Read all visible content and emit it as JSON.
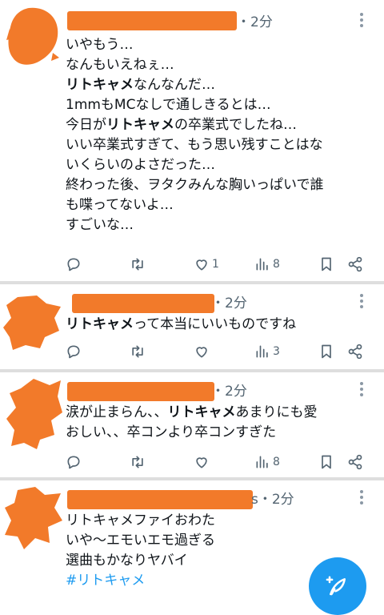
{
  "tweets": [
    {
      "time": "・2分",
      "lines": [
        [
          {
            "t": "いやもう…"
          }
        ],
        [
          {
            "t": "なんもいえねぇ…"
          }
        ],
        [
          {
            "t": "リトキャメ",
            "b": true
          },
          {
            "t": "なんなんだ…"
          }
        ],
        [
          {
            "t": "1mmもMCなしで通しきるとは…"
          }
        ],
        [
          {
            "t": "今日が"
          },
          {
            "t": "リトキャメ",
            "b": true
          },
          {
            "t": "の卒業式でしたね…"
          }
        ],
        [
          {
            "t": "いい卒業式すぎて、もう思い残すことはな"
          }
        ],
        [
          {
            "t": "いくらいのよさだった…"
          }
        ],
        [
          {
            "t": "終わった後、ヲタクみんな胸いっぱいで誰"
          }
        ],
        [
          {
            "t": "も喋ってないよ…"
          }
        ],
        [
          {
            "t": "すごいな…"
          }
        ]
      ],
      "likes": "1",
      "views": "8"
    },
    {
      "time": "・2分",
      "lines": [
        [
          {
            "t": "リトキャメ",
            "b": true
          },
          {
            "t": "って本当にいいものですね"
          }
        ]
      ],
      "likes": "",
      "views": "3"
    },
    {
      "time": "・2分",
      "lines": [
        [
          {
            "t": "涙が止まらん、、"
          },
          {
            "t": "リトキャメ",
            "b": true
          },
          {
            "t": "あまりにも愛"
          }
        ],
        [
          {
            "t": "おしい、、卒コンより卒コンすぎた"
          }
        ]
      ],
      "likes": "",
      "views": "8"
    },
    {
      "time": "s・2分",
      "lines": [
        [
          {
            "t": "リトキャメファイおわた"
          }
        ],
        [
          {
            "t": "いや〜エモいエモ過ぎる"
          }
        ],
        [
          {
            "t": "選曲もかなりヤバイ"
          }
        ],
        [
          {
            "t": "#リトキャメ",
            "tag": true
          }
        ]
      ],
      "likes": "",
      "views": ""
    }
  ],
  "colors": {
    "accent": "#1d9bf0",
    "text": "#0f1419",
    "muted": "#536471",
    "redaction": "#f27a2a",
    "separator": "#dedede"
  },
  "icons": {
    "reply": "reply-icon",
    "retweet": "retweet-icon",
    "like": "heart-icon",
    "views": "views-icon",
    "bookmark": "bookmark-icon",
    "share": "share-icon",
    "compose": "compose-feather-icon"
  }
}
